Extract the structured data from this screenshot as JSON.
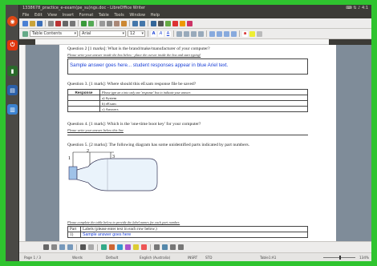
{
  "window": {
    "title": "1338678_practice_e-exam(pe_su)ngs.doc - LibreOffice Writer",
    "tray_time": "4:1",
    "tray_icons": [
      "keyboard-icon",
      "network-icon",
      "volume-icon"
    ]
  },
  "menu": [
    "File",
    "Edit",
    "View",
    "Insert",
    "Format",
    "Table",
    "Tools",
    "Window",
    "Help"
  ],
  "format_bar": {
    "style": "Table Contents",
    "font": "Arial",
    "size": "12"
  },
  "document": {
    "q2_partial": "Question 2 [1 marks]: What is the brand/make/manufacturer of your computer?",
    "q2_instruction": "Please write your answer inside the box below - place the cursor inside the box and start typing!",
    "sample_answer": "Sample answer goes here... student responses appear in blue Ariel text.",
    "q3": "Question 3. [1 mark]: Where should this eExam response file be saved?",
    "q3_table": {
      "header": "Response",
      "header_hint": "Please type an x into only one 'response' box to indicate your answer.",
      "options": [
        "a) System",
        "b) eExam",
        "c) Answers"
      ]
    },
    "q4": "Question 4. [1 mark]: Which is the 'one-time boot key' for your computer?",
    "q4_instruction": "Please write your answer below this line",
    "q5": "Question 5. [2 marks]: The following diagram has some unidentified parts indicated by part numbers.",
    "diagram_labels": [
      "1",
      "2",
      "3"
    ],
    "q5_instruction": "Please complete the table below to provide the label names for each part number.",
    "label_table": {
      "col1": "Part",
      "col2": "Labels (please enter text in each row below.)",
      "row1_part": "1)",
      "row1_label": "Sample answer goes here"
    }
  },
  "status": {
    "page": "Page 1 / 3",
    "words": "Words",
    "style": "Default",
    "language": "English (Australia)",
    "mode": "INSRT",
    "std": "STD",
    "table": "Table1:A1",
    "zoom": "134%"
  },
  "colors": {
    "desktop": "#2fc42f",
    "answer_text": "#1a3fd6"
  }
}
